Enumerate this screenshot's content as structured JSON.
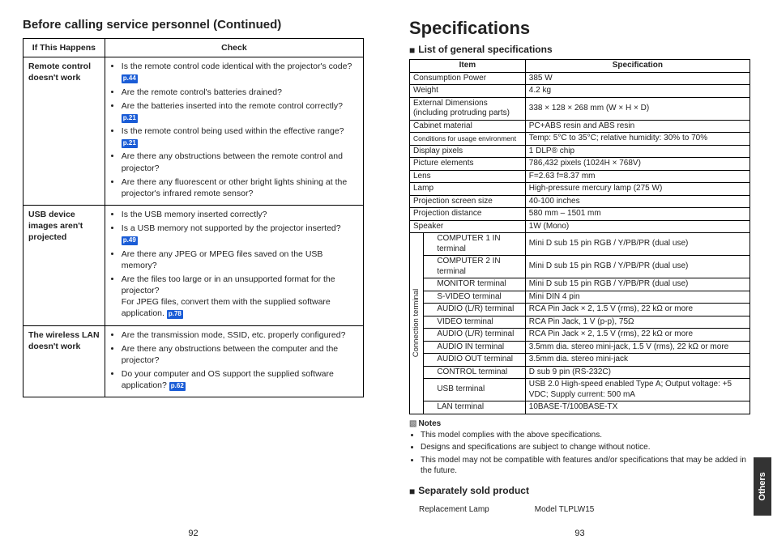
{
  "left": {
    "section_title": "Before calling service personnel (Continued)",
    "header_if": "If This Happens",
    "header_check": "Check",
    "rows": [
      {
        "issue": "Remote control doesn't work",
        "checks": [
          {
            "text": "Is the remote control code identical with the projector's code?",
            "ref": "p.44"
          },
          {
            "text": "Are the remote control's batteries drained?"
          },
          {
            "text": "Are the batteries inserted into the remote control correctly?",
            "ref": "p.21"
          },
          {
            "text": "Is the remote control being used within the effective range?",
            "ref": "p.21"
          },
          {
            "text": "Are there any obstructions between the remote control and projector?"
          },
          {
            "text": "Are there any fluorescent or other bright lights shining at the projector's infrared remote sensor?"
          }
        ]
      },
      {
        "issue": "USB device images aren't projected",
        "checks": [
          {
            "text": "Is the USB memory inserted correctly?"
          },
          {
            "text": "Is a USB memory not supported by the projector inserted?",
            "ref": "p.49"
          },
          {
            "text": "Are there any JPEG or MPEG files saved on the USB memory?"
          },
          {
            "text": "Are the files too large or in an unsupported format for the projector?",
            "tail": "For JPEG files, convert them with the supplied software application.",
            "tailref": "p.78"
          }
        ]
      },
      {
        "issue": "The wireless LAN doesn't work",
        "checks": [
          {
            "text": "Are the transmission mode, SSID, etc. properly configured?"
          },
          {
            "text": "Are there any obstructions between the computer and the projector?"
          },
          {
            "text": "Do your computer and OS support the supplied software application?",
            "ref": "p.62"
          }
        ]
      }
    ],
    "page_number": "92"
  },
  "right": {
    "chapter_title": "Specifications",
    "list_title": "List of general specifications",
    "header_item": "Item",
    "header_spec": "Specification",
    "specs_top": [
      {
        "item": "Consumption Power",
        "val": "385 W"
      },
      {
        "item": "Weight",
        "val": "4.2 kg"
      },
      {
        "item": "External Dimensions (including protruding parts)",
        "val": "338 × 128 × 268 mm (W × H × D)"
      },
      {
        "item": "Cabinet material",
        "val": "PC+ABS resin and ABS resin"
      },
      {
        "item": "Conditions for usage environment",
        "val": "Temp: 5°C to 35°C; relative humidity: 30% to 70%",
        "small": true
      },
      {
        "item": "Display pixels",
        "val": "1 DLP® chip"
      },
      {
        "item": "Picture elements",
        "val": "786,432 pixels (1024H × 768V)"
      },
      {
        "item": "Lens",
        "val": "F=2.63  f=8.37 mm"
      },
      {
        "item": "Lamp",
        "val": "High-pressure mercury lamp (275 W)"
      },
      {
        "item": "Projection screen size",
        "val": "40-100 inches"
      },
      {
        "item": "Projection distance",
        "val": "580 mm – 1501 mm"
      },
      {
        "item": "Speaker",
        "val": "1W (Mono)"
      }
    ],
    "conn_label": "Connection terminal",
    "conn_rows": [
      {
        "item": "COMPUTER 1 IN terminal",
        "val": "Mini D sub 15 pin  RGB / Y/PB/PR (dual use)"
      },
      {
        "item": "COMPUTER 2 IN terminal",
        "val": "Mini D sub 15 pin  RGB / Y/PB/PR (dual use)"
      },
      {
        "item": "MONITOR terminal",
        "val": "Mini D sub 15 pin  RGB / Y/PB/PR (dual use)"
      },
      {
        "item": "S-VIDEO terminal",
        "val": "Mini DIN 4 pin"
      },
      {
        "item": "AUDIO (L/R) terminal",
        "val": "RCA Pin Jack × 2, 1.5 V (rms), 22 kΩ or more"
      },
      {
        "item": "VIDEO terminal",
        "val": "RCA Pin Jack, 1 V (p-p), 75Ω"
      },
      {
        "item": "AUDIO (L/R) terminal",
        "val": "RCA Pin Jack × 2, 1.5 V (rms), 22 kΩ or more"
      },
      {
        "item": "AUDIO IN terminal",
        "val": "3.5mm dia. stereo mini-jack, 1.5 V (rms), 22 kΩ or more"
      },
      {
        "item": "AUDIO OUT terminal",
        "val": "3.5mm dia. stereo mini-jack"
      },
      {
        "item": "CONTROL terminal",
        "val": "D sub 9 pin (RS-232C)"
      },
      {
        "item": "USB terminal",
        "val": "USB 2.0 High-speed enabled Type A; Output voltage: +5 VDC; Supply current: 500 mA"
      },
      {
        "item": "LAN terminal",
        "val": "10BASE-T/100BASE-TX"
      }
    ],
    "notes_title": "Notes",
    "notes": [
      "This model complies with the above specifications.",
      "Designs and specifications are subject to change without notice.",
      "This model may not be compatible with features and/or specifications that may be added in the future."
    ],
    "sep_title": "Separately sold product",
    "sep_label": "Replacement Lamp",
    "sep_model": "Model TLPLW15",
    "side_tab": "Others",
    "page_number": "93"
  }
}
